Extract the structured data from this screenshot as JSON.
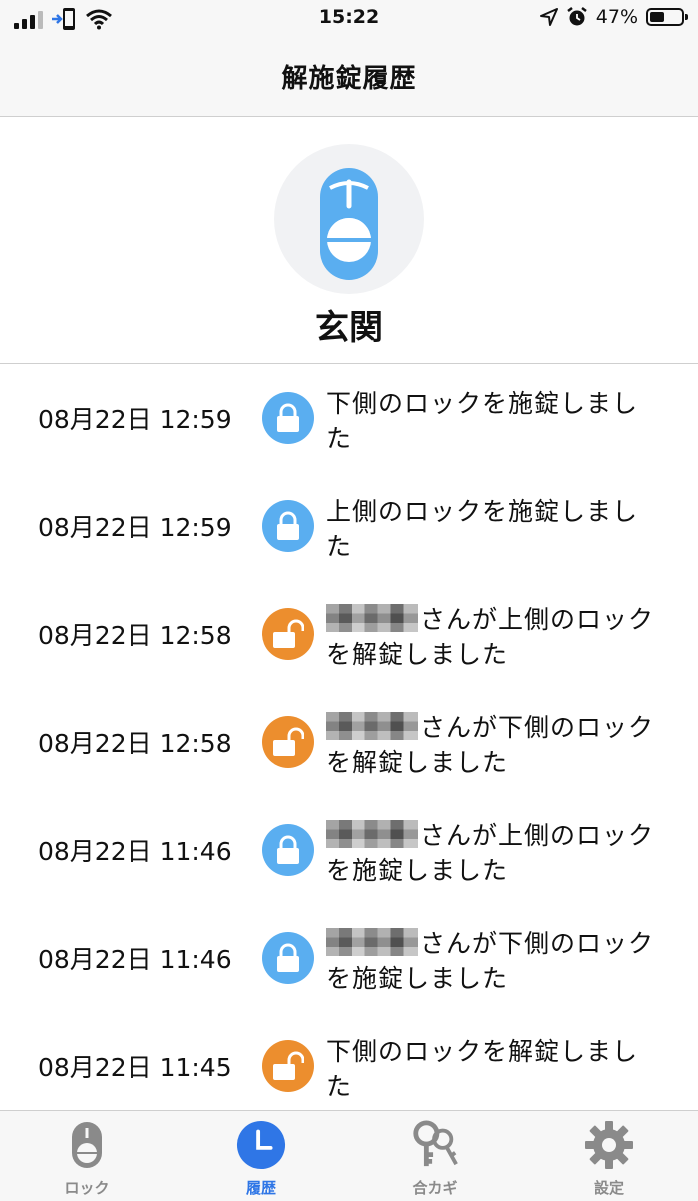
{
  "status_bar": {
    "time": "15:22",
    "battery": "47%",
    "battery_level": 0.47
  },
  "nav": {
    "title": "解施錠履歴"
  },
  "lock": {
    "name": "玄関"
  },
  "history": [
    {
      "time": "08月22日 12:59",
      "state": "locked",
      "redacted": false,
      "text": "下側のロックを施錠しました"
    },
    {
      "time": "08月22日 12:59",
      "state": "locked",
      "redacted": false,
      "text": "上側のロックを施錠しました"
    },
    {
      "time": "08月22日 12:58",
      "state": "unlocked",
      "redacted": true,
      "text": "さんが上側のロックを解錠しました"
    },
    {
      "time": "08月22日 12:58",
      "state": "unlocked",
      "redacted": true,
      "text": "さんが下側のロックを解錠しました"
    },
    {
      "time": "08月22日 11:46",
      "state": "locked",
      "redacted": true,
      "text": "さんが上側のロックを施錠しました"
    },
    {
      "time": "08月22日 11:46",
      "state": "locked",
      "redacted": true,
      "text": "さんが下側のロックを施錠しました"
    },
    {
      "time": "08月22日 11:45",
      "state": "unlocked",
      "redacted": false,
      "text": "下側のロックを解錠しました"
    }
  ],
  "tabs": [
    {
      "label": "ロック",
      "icon": "lock-device-icon",
      "active": false
    },
    {
      "label": "履歴",
      "icon": "clock-icon",
      "active": true
    },
    {
      "label": "合カギ",
      "icon": "keys-icon",
      "active": false
    },
    {
      "label": "設定",
      "icon": "gear-icon",
      "active": false
    }
  ],
  "colors": {
    "locked": "#5aaef0",
    "unlocked": "#ec8e2e",
    "active_tab": "#2f76e6",
    "inactive_tab": "#8a8a8a"
  }
}
